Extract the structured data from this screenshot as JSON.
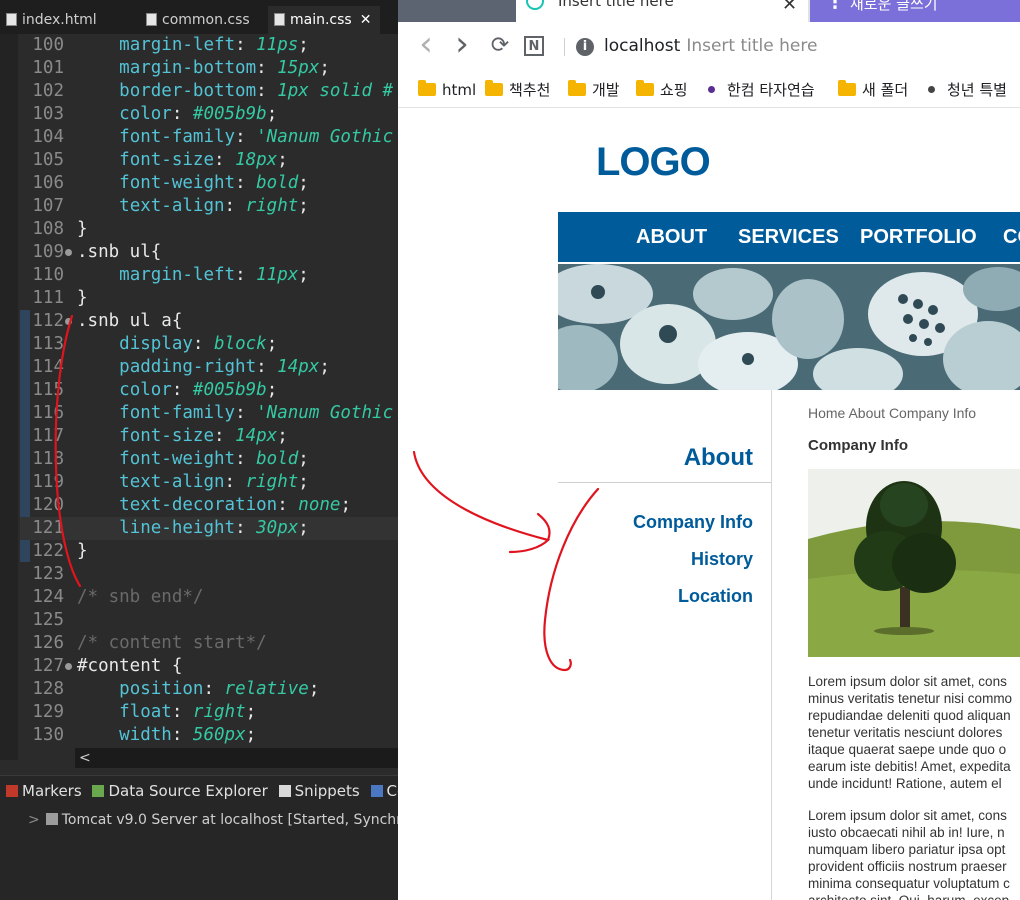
{
  "ide": {
    "tabs": [
      {
        "label": "index.html"
      },
      {
        "label": "common.css"
      },
      {
        "label": "main.css",
        "close": "✕"
      }
    ],
    "lines": [
      {
        "n": "100",
        "parts": [
          [
            "    ",
            "plain"
          ],
          [
            "margin-left",
            "prop"
          ],
          [
            ": ",
            "plain"
          ],
          [
            "11ps",
            "val"
          ],
          [
            ";",
            "plain"
          ]
        ]
      },
      {
        "n": "101",
        "parts": [
          [
            "    ",
            "plain"
          ],
          [
            "margin-bottom",
            "prop"
          ],
          [
            ": ",
            "plain"
          ],
          [
            "15px",
            "val"
          ],
          [
            ";",
            "plain"
          ]
        ]
      },
      {
        "n": "102",
        "parts": [
          [
            "    ",
            "plain"
          ],
          [
            "border-bottom",
            "prop"
          ],
          [
            ": ",
            "plain"
          ],
          [
            "1px solid #",
            "val"
          ]
        ]
      },
      {
        "n": "103",
        "parts": [
          [
            "    ",
            "plain"
          ],
          [
            "color",
            "prop"
          ],
          [
            ": ",
            "plain"
          ],
          [
            "#005b9b",
            "val"
          ],
          [
            ";",
            "plain"
          ]
        ]
      },
      {
        "n": "104",
        "parts": [
          [
            "    ",
            "plain"
          ],
          [
            "font-family",
            "prop"
          ],
          [
            ": ",
            "plain"
          ],
          [
            "'Nanum Gothic",
            "val"
          ]
        ]
      },
      {
        "n": "105",
        "parts": [
          [
            "    ",
            "plain"
          ],
          [
            "font-size",
            "prop"
          ],
          [
            ": ",
            "plain"
          ],
          [
            "18px",
            "val"
          ],
          [
            ";",
            "plain"
          ]
        ]
      },
      {
        "n": "106",
        "parts": [
          [
            "    ",
            "plain"
          ],
          [
            "font-weight",
            "prop"
          ],
          [
            ": ",
            "plain"
          ],
          [
            "bold",
            "val"
          ],
          [
            ";",
            "plain"
          ]
        ]
      },
      {
        "n": "107",
        "parts": [
          [
            "    ",
            "plain"
          ],
          [
            "text-align",
            "prop"
          ],
          [
            ": ",
            "plain"
          ],
          [
            "right",
            "val"
          ],
          [
            ";",
            "plain"
          ]
        ]
      },
      {
        "n": "108",
        "parts": [
          [
            "}",
            "plain"
          ]
        ]
      },
      {
        "n": "109",
        "fold": true,
        "parts": [
          [
            ".snb ul",
            "sel"
          ],
          [
            "{",
            "plain"
          ]
        ]
      },
      {
        "n": "110",
        "parts": [
          [
            "    ",
            "plain"
          ],
          [
            "margin-left",
            "prop"
          ],
          [
            ": ",
            "plain"
          ],
          [
            "11px",
            "val"
          ],
          [
            ";",
            "plain"
          ]
        ]
      },
      {
        "n": "111",
        "parts": [
          [
            "}",
            "plain"
          ]
        ]
      },
      {
        "n": "112",
        "fold": true,
        "parts": [
          [
            ".snb ul a",
            "sel"
          ],
          [
            "{",
            "plain"
          ]
        ]
      },
      {
        "n": "113",
        "parts": [
          [
            "    ",
            "plain"
          ],
          [
            "display",
            "prop"
          ],
          [
            ": ",
            "plain"
          ],
          [
            "block",
            "val"
          ],
          [
            ";",
            "plain"
          ]
        ]
      },
      {
        "n": "114",
        "parts": [
          [
            "    ",
            "plain"
          ],
          [
            "padding-right",
            "prop"
          ],
          [
            ": ",
            "plain"
          ],
          [
            "14px",
            "val"
          ],
          [
            ";",
            "plain"
          ]
        ]
      },
      {
        "n": "115",
        "parts": [
          [
            "    ",
            "plain"
          ],
          [
            "color",
            "prop"
          ],
          [
            ": ",
            "plain"
          ],
          [
            "#005b9b",
            "val"
          ],
          [
            ";",
            "plain"
          ]
        ]
      },
      {
        "n": "116",
        "parts": [
          [
            "    ",
            "plain"
          ],
          [
            "font-family",
            "prop"
          ],
          [
            ": ",
            "plain"
          ],
          [
            "'Nanum Gothic",
            "val"
          ]
        ]
      },
      {
        "n": "117",
        "parts": [
          [
            "    ",
            "plain"
          ],
          [
            "font-size",
            "prop"
          ],
          [
            ": ",
            "plain"
          ],
          [
            "14px",
            "val"
          ],
          [
            ";",
            "plain"
          ]
        ]
      },
      {
        "n": "118",
        "parts": [
          [
            "    ",
            "plain"
          ],
          [
            "font-weight",
            "prop"
          ],
          [
            ": ",
            "plain"
          ],
          [
            "bold",
            "val"
          ],
          [
            ";",
            "plain"
          ]
        ]
      },
      {
        "n": "119",
        "parts": [
          [
            "    ",
            "plain"
          ],
          [
            "text-align",
            "prop"
          ],
          [
            ": ",
            "plain"
          ],
          [
            "right",
            "val"
          ],
          [
            ";",
            "plain"
          ]
        ]
      },
      {
        "n": "120",
        "parts": [
          [
            "    ",
            "plain"
          ],
          [
            "text-decoration",
            "prop"
          ],
          [
            ": ",
            "plain"
          ],
          [
            "none",
            "val"
          ],
          [
            ";",
            "plain"
          ]
        ]
      },
      {
        "n": "121",
        "highlight": true,
        "parts": [
          [
            "    ",
            "plain"
          ],
          [
            "line-height",
            "prop"
          ],
          [
            ": ",
            "plain"
          ],
          [
            "30px",
            "val"
          ],
          [
            ";",
            "plain"
          ]
        ]
      },
      {
        "n": "122",
        "parts": [
          [
            "}",
            "plain"
          ]
        ]
      },
      {
        "n": "123",
        "parts": []
      },
      {
        "n": "124",
        "parts": [
          [
            "/* snb end*/",
            "com"
          ]
        ]
      },
      {
        "n": "125",
        "parts": []
      },
      {
        "n": "126",
        "parts": [
          [
            "/* content start*/",
            "com"
          ]
        ]
      },
      {
        "n": "127",
        "fold": true,
        "parts": [
          [
            "#content ",
            "sel"
          ],
          [
            "{",
            "plain"
          ]
        ]
      },
      {
        "n": "128",
        "parts": [
          [
            "    ",
            "plain"
          ],
          [
            "position",
            "prop"
          ],
          [
            ": ",
            "plain"
          ],
          [
            "relative",
            "val"
          ],
          [
            ";",
            "plain"
          ]
        ]
      },
      {
        "n": "129",
        "parts": [
          [
            "    ",
            "plain"
          ],
          [
            "float",
            "prop"
          ],
          [
            ": ",
            "plain"
          ],
          [
            "right",
            "val"
          ],
          [
            ";",
            "plain"
          ]
        ]
      },
      {
        "n": "130",
        "parts": [
          [
            "    ",
            "plain"
          ],
          [
            "width",
            "prop"
          ],
          [
            ": ",
            "plain"
          ],
          [
            "560px",
            "val"
          ],
          [
            ";",
            "plain"
          ]
        ]
      }
    ],
    "hscroll_arrow": "<",
    "bottom_tabs": [
      "Markers",
      "Data Source Explorer",
      "Snippets",
      "Co"
    ],
    "server": {
      "arrow": ">",
      "label": "Tomcat v9.0 Server at localhost  [Started, Synchro"
    }
  },
  "browser": {
    "tab_active": {
      "title": "Insert title here",
      "close": "✕"
    },
    "tab_newpost": {
      "dots": "⋮",
      "label": "새로운 글쓰기"
    },
    "nav": {
      "back": "‹",
      "forward": "›",
      "reload": "⟳",
      "ext": "N"
    },
    "address": {
      "info": "i",
      "host": "localhost",
      "title": "Insert title here"
    },
    "bookmarks": [
      {
        "label": "html",
        "kind": "folder"
      },
      {
        "label": "책추천",
        "kind": "folder"
      },
      {
        "label": "개발",
        "kind": "folder"
      },
      {
        "label": "쇼핑",
        "kind": "folder"
      },
      {
        "label": "한컴 타자연습",
        "kind": "dot",
        "color": "#5b2c91"
      },
      {
        "label": "새 폴더",
        "kind": "folder"
      },
      {
        "label": "청년 특별",
        "kind": "dot",
        "color": "#444444"
      }
    ]
  },
  "page": {
    "logo": "LOGO",
    "gnb": [
      "ABOUT",
      "SERVICES",
      "PORTFOLIO",
      "CO"
    ],
    "snb": {
      "title": "About",
      "items": [
        "Company Info",
        "History",
        "Location"
      ]
    },
    "breadcrumb": "Home About Company Info",
    "content_title": "Company Info",
    "para1": [
      "Lorem ipsum dolor sit amet, cons",
      "minus veritatis tenetur nisi commo",
      "repudiandae deleniti quod aliquan",
      "tenetur veritatis nesciunt dolores",
      "itaque quaerat saepe unde quo o",
      "earum iste debitis! Amet, expedita",
      "unde incidunt! Ratione, autem el"
    ],
    "para2": [
      "Lorem ipsum dolor sit amet, cons",
      "iusto obcaecati nihil ab in! Iure, n",
      "numquam libero pariatur ipsa opt",
      "provident officiis nostrum praeser",
      "minima consequatur voluptatum c",
      "architecto sint. Qui, harum, excep"
    ]
  },
  "colors": {
    "brand": "#005b9b",
    "annotation": "#e0141e"
  },
  "icons": [
    "file-icon",
    "close-icon",
    "back-icon",
    "forward-icon",
    "reload-icon",
    "info-icon",
    "folder-icon",
    "tab-loading-icon",
    "menu-dots-icon"
  ]
}
